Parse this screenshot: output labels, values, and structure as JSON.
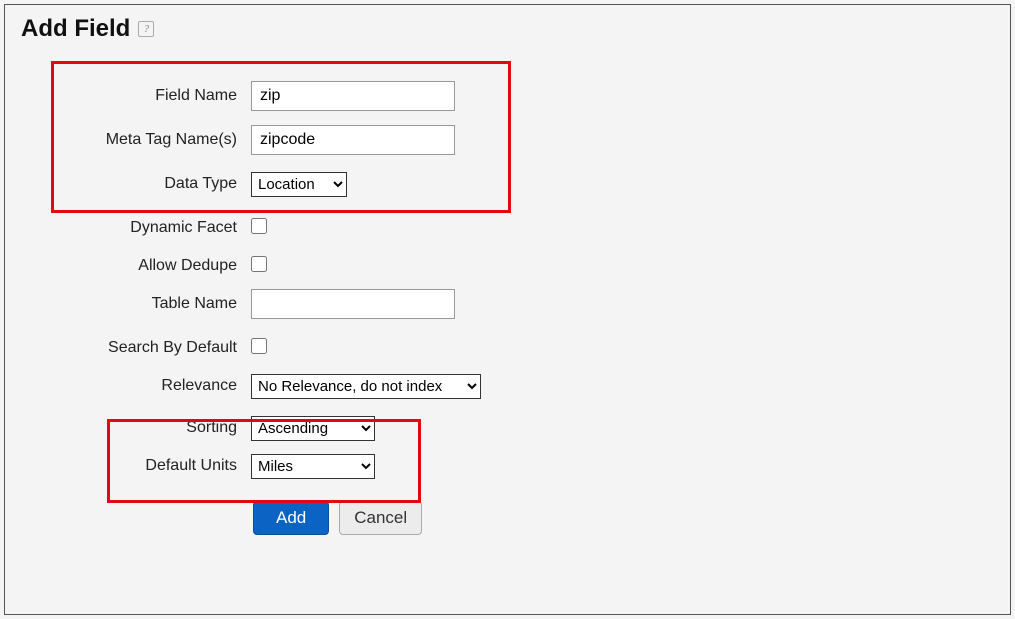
{
  "panel": {
    "title": "Add Field",
    "help_glyph": "?"
  },
  "labels": {
    "field_name": "Field Name",
    "meta_tag_names": "Meta Tag Name(s)",
    "data_type": "Data Type",
    "dynamic_facet": "Dynamic Facet",
    "allow_dedupe": "Allow Dedupe",
    "table_name": "Table Name",
    "search_by_default": "Search By Default",
    "relevance": "Relevance",
    "sorting": "Sorting",
    "default_units": "Default Units"
  },
  "values": {
    "field_name": "zip",
    "meta_tag_names": "zipcode",
    "data_type": "Location",
    "table_name": "",
    "relevance": "No Relevance, do not index",
    "sorting": "Ascending",
    "default_units": "Miles"
  },
  "buttons": {
    "add": "Add",
    "cancel": "Cancel"
  }
}
